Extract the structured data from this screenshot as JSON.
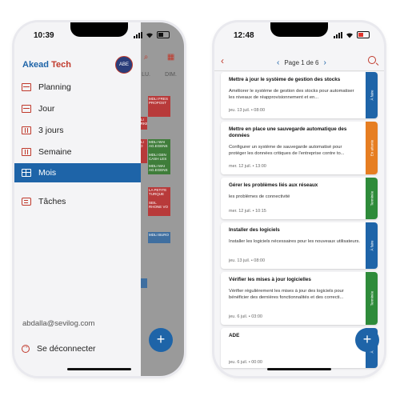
{
  "left_phone": {
    "status": {
      "time": "10:39"
    },
    "calendar_bg": {
      "days": [
        "LU.",
        "DIM."
      ],
      "events": [
        "MDLI FRES PROPOST",
        "MDLI MARKE",
        "MDLI SEO",
        "MDLI WAI AG.EGENS",
        "MDLI GEN CASH LES",
        "MDLI MAI AG.EGENS",
        "LA PETITE TURQUE",
        "SEIL RHONE VO",
        "MDLI BURO"
      ]
    },
    "brand": {
      "part1": "Akead",
      "part2": "Tech"
    },
    "avatar": "ABE",
    "menu": [
      {
        "label": "Planning"
      },
      {
        "label": "Jour"
      },
      {
        "label": "3 jours"
      },
      {
        "label": "Semaine"
      },
      {
        "label": "Mois",
        "active": true
      },
      {
        "label": "Tâches"
      }
    ],
    "email": "abdalla@sevilog.com",
    "logout": "Se déconnecter",
    "fab": "+"
  },
  "right_phone": {
    "status": {
      "time": "12:48"
    },
    "header": {
      "page_label": "Page 1 de 6",
      "prev": "‹",
      "next": "›",
      "back": "‹"
    },
    "tasks": [
      {
        "title": "Mettre à jour le système de gestion des stocks",
        "description": "Améliorer le système de gestion des stocks pour automatiser les niveaux de réapprovisionnement et en...",
        "date": "jeu. 13 juil. • 08:00",
        "status": "À faire",
        "status_color": "#1e64a8"
      },
      {
        "title": "Mettre en place une sauvegarde automatique des données",
        "description": "Configurer un système de sauvegarde automatisé pour protéger les données critiques de l'entreprise contre to...",
        "date": "mer. 12 juil. • 13:00",
        "status": "En attente",
        "status_color": "#e67e22"
      },
      {
        "title": "Gérer les problèmes liés aux réseaux",
        "description": "les problèmes de connectivité",
        "date": "mer. 12 juil. • 10:15",
        "status": "Terminée",
        "status_color": "#2e8b3a"
      },
      {
        "title": "Installer des logiciels",
        "description": "Installer les logiciels nécessaires pour les nouveaux utilisateurs.",
        "date": "jeu. 13 juil. • 08:00",
        "status": "À faire",
        "status_color": "#1e64a8"
      },
      {
        "title": "Vérifier les mises à jour logicielles",
        "description": "Vérifier régulièrement les mises à jour des logiciels pour bénéficier des dernières fonctionnalités et des correcti...",
        "date": "jeu. 6 juil. • 03:00",
        "status": "Terminée",
        "status_color": "#2e8b3a"
      },
      {
        "title": "ADE",
        "description": "",
        "date": "jeu. 6 juil. • 00:00",
        "status": "À faire",
        "status_color": "#1e64a8"
      }
    ],
    "fab": "+"
  }
}
